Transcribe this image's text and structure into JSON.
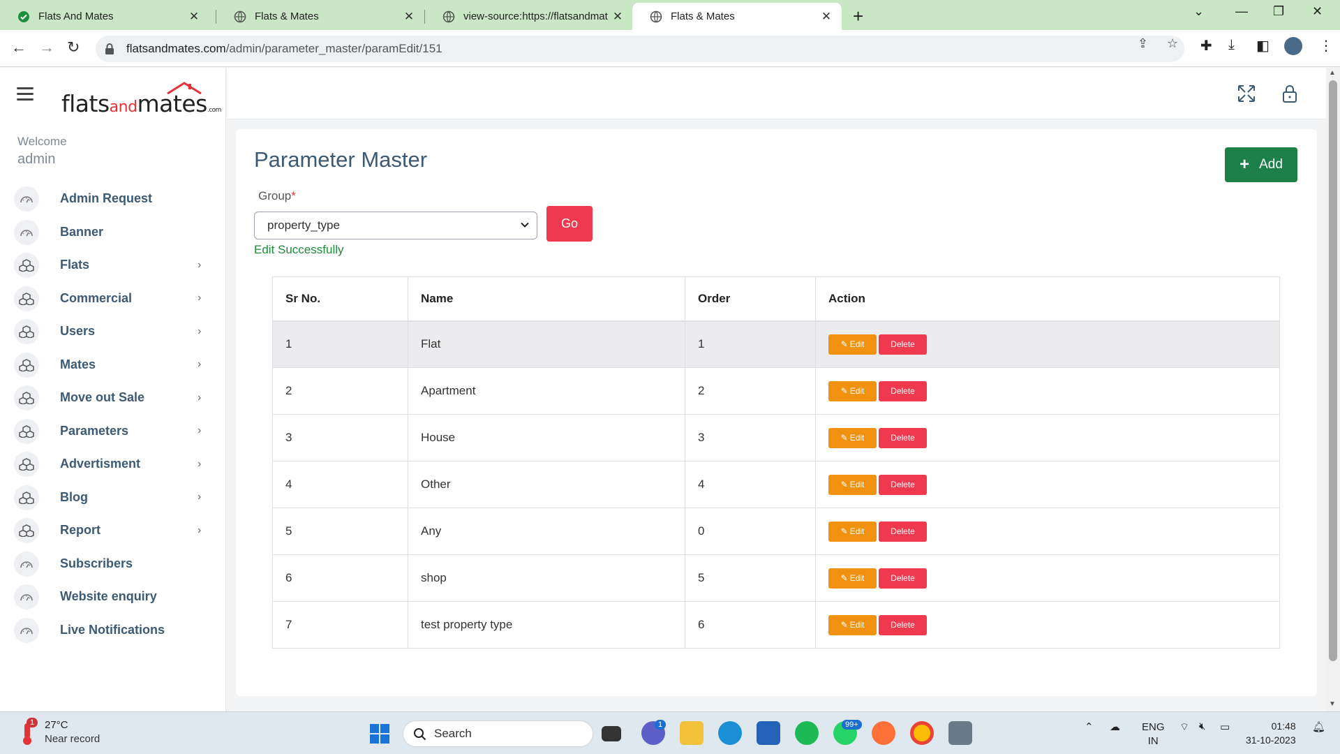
{
  "browser": {
    "tabs": [
      {
        "title": "Flats And Mates",
        "icon": "check-circle-icon",
        "active": false
      },
      {
        "title": "Flats & Mates",
        "icon": "globe-icon",
        "active": false
      },
      {
        "title": "view-source:https://flatsandmat",
        "icon": "globe-icon",
        "active": false
      },
      {
        "title": "Flats & Mates",
        "icon": "globe-icon",
        "active": true
      }
    ],
    "url_host": "flatsandmates.com",
    "url_path": "/admin/parameter_master/paramEdit/151"
  },
  "sidebar": {
    "logo_parts": {
      "a": "flats",
      "b": "and",
      "c": "mates",
      "d": ".com"
    },
    "welcome": "Welcome",
    "username": "admin",
    "items": [
      {
        "label": "Admin Request",
        "has_arrow": false,
        "icon": "dashboard-icon"
      },
      {
        "label": "Banner",
        "has_arrow": false,
        "icon": "dashboard-icon"
      },
      {
        "label": "Flats",
        "has_arrow": true,
        "icon": "cubes-icon"
      },
      {
        "label": "Commercial",
        "has_arrow": true,
        "icon": "cubes-icon"
      },
      {
        "label": "Users",
        "has_arrow": true,
        "icon": "cubes-icon"
      },
      {
        "label": "Mates",
        "has_arrow": true,
        "icon": "cubes-icon"
      },
      {
        "label": "Move out Sale",
        "has_arrow": true,
        "icon": "cubes-icon"
      },
      {
        "label": "Parameters",
        "has_arrow": true,
        "icon": "cubes-icon"
      },
      {
        "label": "Advertisment",
        "has_arrow": true,
        "icon": "cubes-icon"
      },
      {
        "label": "Blog",
        "has_arrow": true,
        "icon": "cubes-icon"
      },
      {
        "label": "Report",
        "has_arrow": true,
        "icon": "cubes-icon"
      },
      {
        "label": "Subscribers",
        "has_arrow": false,
        "icon": "dashboard-icon"
      },
      {
        "label": "Website enquiry",
        "has_arrow": false,
        "icon": "dashboard-icon"
      },
      {
        "label": "Live Notifications",
        "has_arrow": false,
        "icon": "dashboard-icon"
      }
    ]
  },
  "main": {
    "title": "Parameter Master",
    "add_label": "Add",
    "group_label": "Group",
    "group_required_mark": "*",
    "group_selected": "property_type",
    "go_label": "Go",
    "success_message": "Edit Successfully",
    "table": {
      "headers": [
        "Sr No.",
        "Name",
        "Order",
        "Action"
      ],
      "edit_label": "Edit",
      "delete_label": "Delete",
      "rows": [
        {
          "sr": "1",
          "name": "Flat",
          "order": "1"
        },
        {
          "sr": "2",
          "name": "Apartment",
          "order": "2"
        },
        {
          "sr": "3",
          "name": "House",
          "order": "3"
        },
        {
          "sr": "4",
          "name": "Other",
          "order": "4"
        },
        {
          "sr": "5",
          "name": "Any",
          "order": "0"
        },
        {
          "sr": "6",
          "name": "shop",
          "order": "5"
        },
        {
          "sr": "7",
          "name": "test property type",
          "order": "6"
        }
      ]
    }
  },
  "taskbar": {
    "weather_temp": "27°C",
    "weather_desc": "Near record",
    "weather_badge": "1",
    "search_placeholder": "Search",
    "chat_badge": "1",
    "whatsapp_badge": "99+",
    "lang_top": "ENG",
    "lang_bottom": "IN",
    "time": "01:48",
    "date": "31-10-2023"
  },
  "colors": {
    "tabbar": "#c9e7c4",
    "accent_green": "#1c8048",
    "accent_red": "#f0384f",
    "edit_orange": "#f0920f",
    "menu_text": "#3d5a75"
  }
}
